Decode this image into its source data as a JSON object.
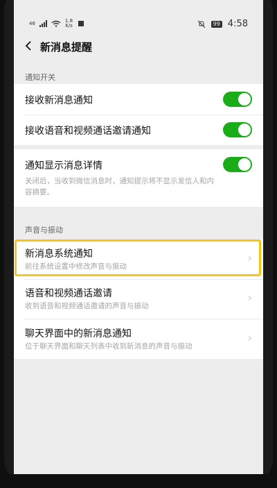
{
  "status_bar": {
    "network_label": "46",
    "speed_value": "1.8",
    "speed_unit": "K/s",
    "battery": "99",
    "time": "4:58"
  },
  "nav": {
    "title": "新消息提醒"
  },
  "sections": {
    "notify_switch_header": "通知开关",
    "sound_vibration_header": "声音与振动"
  },
  "toggles": {
    "receive_new_msg": {
      "label": "接收新消息通知",
      "on": true
    },
    "receive_call_invite": {
      "label": "接收语音和视频通话邀请通知",
      "on": true
    },
    "show_details": {
      "label": "通知显示消息详情",
      "on": true,
      "desc_line1": "关闭后，当收到微信消息时，通知提示将不显示发信人和内",
      "desc_line2": "容摘要。"
    }
  },
  "sound_items": [
    {
      "title": "新消息系统通知",
      "desc": "前往系统设置中修改声音与振动"
    },
    {
      "title": "语音和视频通话邀请",
      "desc": "收到语音和视频通话邀请的声音与振动"
    },
    {
      "title": "聊天界面中的新消息通知",
      "desc": "位于聊天界面和聊天列表中收到新消息的声音与振动"
    }
  ],
  "colors": {
    "accent_green": "#1aad19",
    "highlight_yellow": "#f5c518"
  }
}
